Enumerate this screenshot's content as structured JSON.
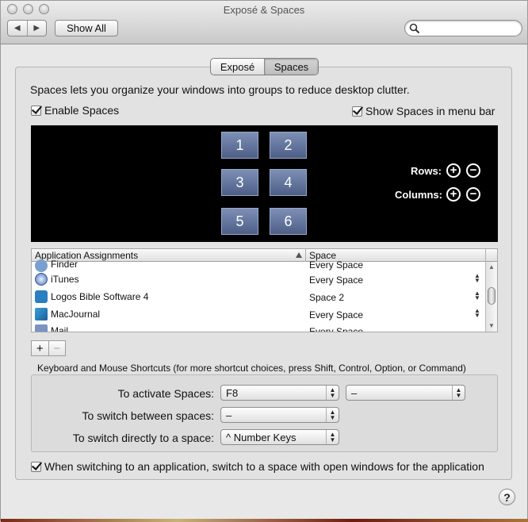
{
  "window": {
    "title": "Exposé & Spaces"
  },
  "toolbar": {
    "back_label": "◀",
    "forward_label": "▶",
    "show_all_label": "Show All",
    "search_placeholder": ""
  },
  "tabs": [
    {
      "label": "Exposé",
      "active": false
    },
    {
      "label": "Spaces",
      "active": true
    }
  ],
  "spaces": {
    "intro": "Spaces lets you organize your windows into groups to reduce desktop clutter.",
    "enable_label": "Enable Spaces",
    "enable_checked": true,
    "menubar_label": "Show Spaces in menu bar",
    "menubar_checked": true,
    "space_numbers": [
      "1",
      "2",
      "3",
      "4",
      "5",
      "6"
    ],
    "rows_label": "Rows:",
    "columns_label": "Columns:",
    "plus": "+",
    "minus": "−"
  },
  "assignments": {
    "col_app": "Application Assignments",
    "col_space": "Space",
    "rows": [
      {
        "name": "Finder",
        "space": "Every Space"
      },
      {
        "name": "iTunes",
        "space": "Every Space"
      },
      {
        "name": "Logos Bible Software 4",
        "space": "Space 2"
      },
      {
        "name": "MacJournal",
        "space": "Every Space"
      },
      {
        "name": "Mail",
        "space": "Every Space"
      }
    ],
    "add_label": "+",
    "remove_label": "−"
  },
  "shortcuts": {
    "heading": "Keyboard and Mouse Shortcuts (for more shortcut choices, press Shift, Control, Option, or Command)",
    "activate_label": "To activate Spaces:",
    "activate_value": "F8",
    "activate_mouse_value": "–",
    "switch_between_label": "To switch between spaces:",
    "switch_between_value": "–",
    "switch_direct_label": "To switch directly to a space:",
    "switch_direct_value": "^ Number Keys"
  },
  "bottom": {
    "switch_app_label": "When switching to an application, switch to a space with open windows for the application",
    "switch_app_checked": true,
    "help_label": "?"
  },
  "colors": {
    "space_tile": "#5d6f97",
    "preview_bg": "#000000"
  }
}
